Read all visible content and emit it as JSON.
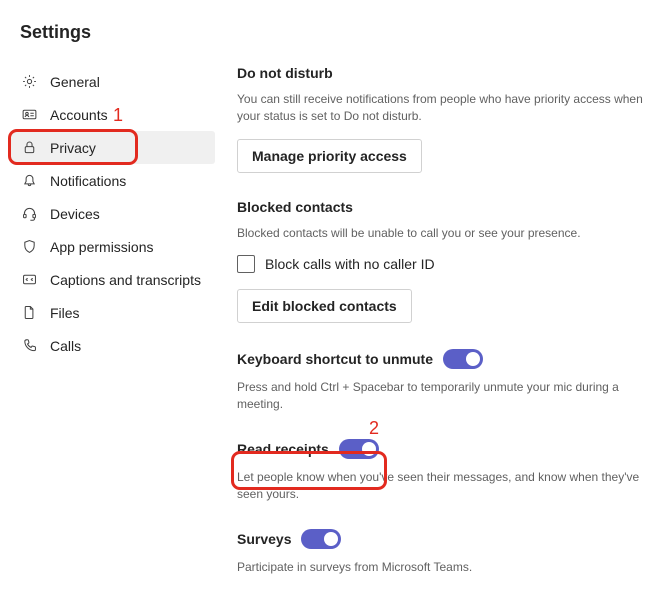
{
  "header": {
    "title": "Settings"
  },
  "sidebar": {
    "items": [
      {
        "label": "General"
      },
      {
        "label": "Accounts"
      },
      {
        "label": "Privacy"
      },
      {
        "label": "Notifications"
      },
      {
        "label": "Devices"
      },
      {
        "label": "App permissions"
      },
      {
        "label": "Captions and transcripts"
      },
      {
        "label": "Files"
      },
      {
        "label": "Calls"
      }
    ]
  },
  "privacy": {
    "dnd": {
      "title": "Do not disturb",
      "desc": "You can still receive notifications from people who have priority access when your status is set to Do not disturb.",
      "button": "Manage priority access"
    },
    "blocked": {
      "title": "Blocked contacts",
      "desc": "Blocked contacts will be unable to call you or see your presence.",
      "checkbox_label": "Block calls with no caller ID",
      "button": "Edit blocked contacts"
    },
    "shortcut": {
      "title": "Keyboard shortcut to unmute",
      "desc": "Press and hold Ctrl + Spacebar to temporarily unmute your mic during a meeting."
    },
    "read_receipts": {
      "title": "Read receipts",
      "desc": "Let people know when you've seen their messages, and know when they've seen yours."
    },
    "surveys": {
      "title": "Surveys",
      "desc": "Participate in surveys from Microsoft Teams."
    }
  },
  "annotations": {
    "n1": "1",
    "n2": "2"
  }
}
